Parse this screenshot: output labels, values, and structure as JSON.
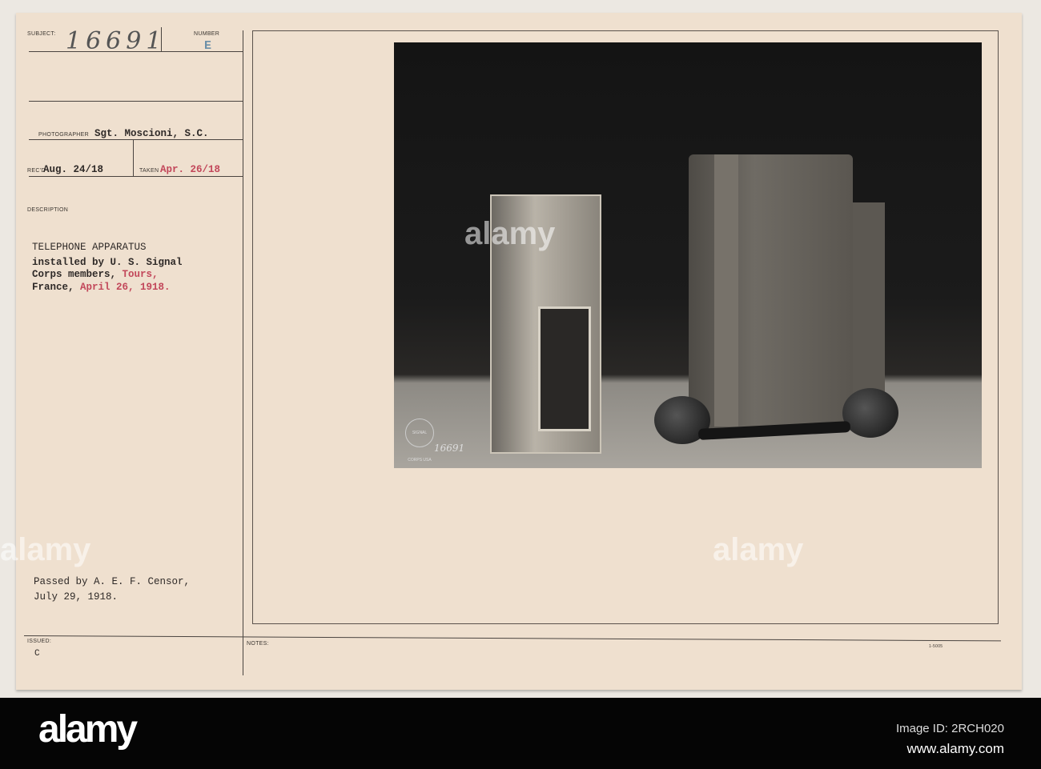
{
  "card": {
    "subject_label": "SUBJECT:",
    "subject_value": "16691",
    "number_label": "NUMBER",
    "number_value": "E",
    "photographer_label": "PHOTOGRAPHER",
    "photographer_value": "Sgt. Moscioni, S.C.",
    "received_label": "REC'D",
    "received_value": "Aug. 24/18",
    "taken_label": "TAKEN",
    "taken_value": "Apr. 26/18",
    "description_label": "DESCRIPTION",
    "description_title": "TELEPHONE APPARATUS",
    "description_line1": "installed by U. S. Signal",
    "description_line2a": "Corps members, ",
    "description_line2b": "Tours,",
    "description_line3a": "France, ",
    "description_line3b": "April 26, 1918.",
    "censor_line1": "Passed by A. E. F. Censor,",
    "censor_line2": "July 29, 1918.",
    "issued_label": "ISSUED:",
    "issued_value": "C",
    "notes_label": "NOTES:",
    "form_number": "1-5005"
  },
  "photo": {
    "stamp_text": "SIGNAL CORPS USA",
    "photo_number": "16691"
  },
  "watermark": {
    "brand": "alamy",
    "image_id": "Image ID: 2RCH020",
    "url": "www.alamy.com"
  }
}
